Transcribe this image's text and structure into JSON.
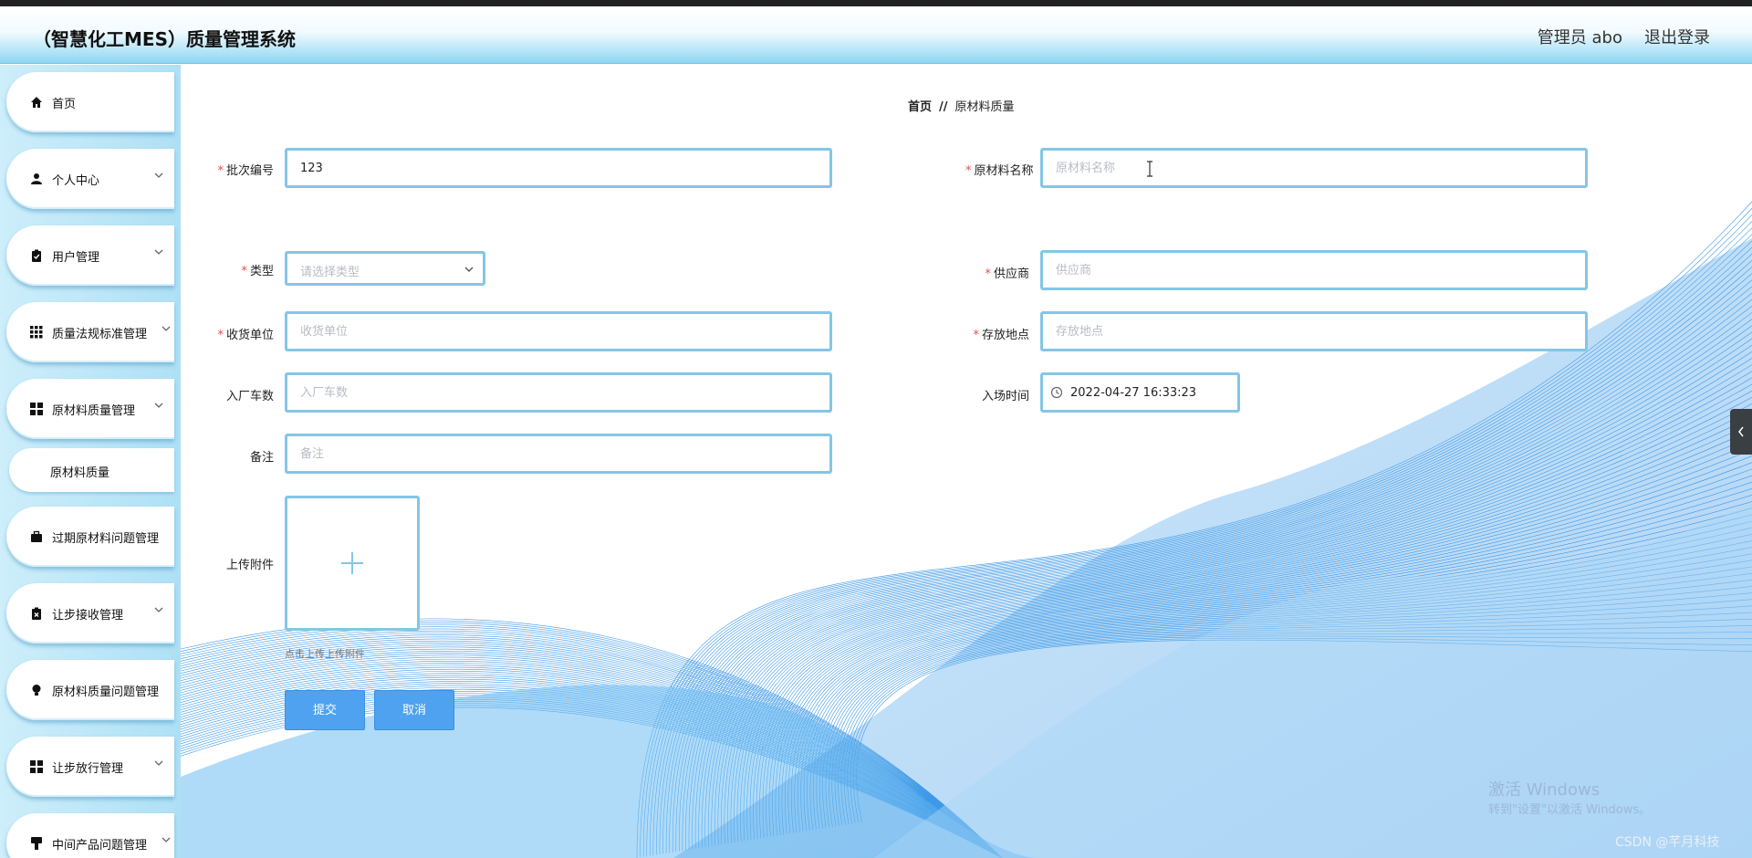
{
  "header": {
    "title": "（智慧化工MES）质量管理系统",
    "admin_label": "管理员 abo",
    "logout_label": "退出登录"
  },
  "sidebar": {
    "items": [
      {
        "label": "首页",
        "icon": "home-icon"
      },
      {
        "label": "个人中心",
        "icon": "user-icon"
      },
      {
        "label": "用户管理",
        "icon": "clipboard-check-icon"
      },
      {
        "label": "质量法规标准管理",
        "icon": "grid-icon"
      },
      {
        "label": "原材料质量管理",
        "icon": "dashboard-icon"
      },
      {
        "label": "过期原材料问题管理",
        "icon": "briefcase-icon"
      },
      {
        "label": "让步接收管理",
        "icon": "clipboard-x-icon"
      },
      {
        "label": "原材料质量问题管理",
        "icon": "bulb-icon"
      },
      {
        "label": "让步放行管理",
        "icon": "dashboard-icon"
      },
      {
        "label": "中间产品问题管理",
        "icon": "brush-icon"
      }
    ],
    "sub_item": "原材料质量"
  },
  "breadcrumb": {
    "home": "首页",
    "separator": "//",
    "current": "原材料质量"
  },
  "form": {
    "batch_no": {
      "label": "批次编号",
      "value": "123",
      "required": true
    },
    "material_name": {
      "label": "原材料名称",
      "placeholder": "原材料名称",
      "required": true
    },
    "type": {
      "label": "类型",
      "placeholder": "请选择类型",
      "required": true
    },
    "supplier": {
      "label": "供应商",
      "placeholder": "供应商",
      "required": true
    },
    "receiving_unit": {
      "label": "收货单位",
      "placeholder": "收货单位",
      "required": true
    },
    "storage_location": {
      "label": "存放地点",
      "placeholder": "存放地点",
      "required": true
    },
    "vehicle_count": {
      "label": "入厂车数",
      "placeholder": "入厂车数",
      "required": false
    },
    "entry_time": {
      "label": "入场时间",
      "value": "2022-04-27 16:33:23",
      "required": false
    },
    "remark": {
      "label": "备注",
      "placeholder": "备注",
      "required": false
    },
    "attachment": {
      "label": "上传附件",
      "hint": "点击上传上传附件"
    },
    "required_mark": "*",
    "submit_label": "提交",
    "cancel_label": "取消"
  },
  "watermark": {
    "line1": "激活 Windows",
    "line2": "转到\"设置\"以激活 Windows。",
    "csdn": "CSDN @芊月科技"
  },
  "colors": {
    "accent": "#4ea2f0",
    "input_border": "#84c6e4",
    "required": "#e84b4b",
    "sidebar_bg": "#aee0f5"
  }
}
